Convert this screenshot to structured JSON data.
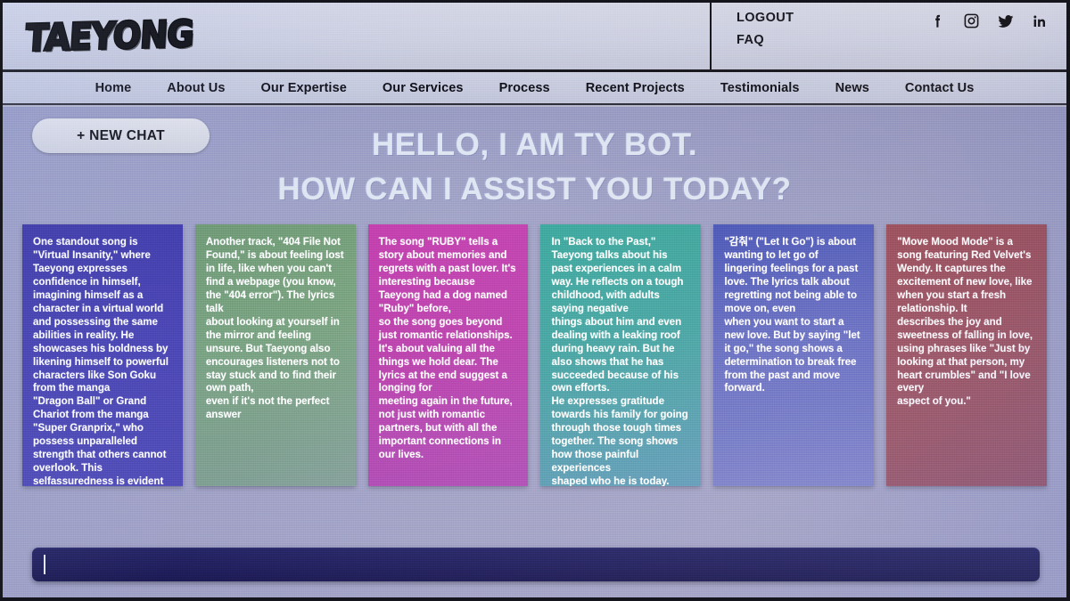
{
  "brand": {
    "logo_text": "TAEYONG"
  },
  "top_bar": {
    "links": [
      {
        "label": "LOGOUT"
      },
      {
        "label": "FAQ"
      }
    ],
    "socials": [
      {
        "name": "facebook-icon",
        "label": "f"
      },
      {
        "name": "instagram-icon",
        "label": ""
      },
      {
        "name": "twitter-icon",
        "label": ""
      },
      {
        "name": "linkedin-icon",
        "label": "in"
      }
    ]
  },
  "nav": {
    "items": [
      {
        "label": "Home"
      },
      {
        "label": "About Us"
      },
      {
        "label": "Our Expertise"
      },
      {
        "label": "Our Services"
      },
      {
        "label": "Process"
      },
      {
        "label": "Recent Projects"
      },
      {
        "label": "Testimonials"
      },
      {
        "label": "News"
      },
      {
        "label": "Contact Us"
      }
    ]
  },
  "main": {
    "new_chat_label": "+ NEW CHAT",
    "headline_line1": "HELLO, I AM TY BOT.",
    "headline_line2": "HOW CAN I ASSIST YOU TODAY?",
    "cards": [
      {
        "accent": "#4a44b4",
        "text": "One standout song is \"Virtual Insanity,\" where Taeyong expresses confidence in himself, imagining himself as a character in a virtual world and possessing the same abilities in reality. He showcases his boldness by likening himself to powerful characters like Son Goku from the manga\n\"Dragon Ball\" or Grand Chariot from the manga \"Super Granprix,\" who possess unparalleled strength that others cannot overlook. This selfassuredness is evident in the song as well."
      },
      {
        "accent": "#7ea585",
        "text": "Another track, \"404 File Not Found,\" is about feeling lost in life, like when you can't find a webpage (you know, the \"404 error\"). The lyrics talk\nabout looking at yourself in the mirror and feeling unsure. But Taeyong also encourages listeners not to stay stuck and to find their own path,\neven if it's not the perfect answer"
      },
      {
        "accent": "#bd45b0",
        "text": "The song \"RUBY\" tells a story about memories and regrets with a past lover. It's interesting because Taeyong had a dog named \"Ruby\" before,\nso the song goes beyond just romantic relationships. It's about valuing all the things we hold dear. The lyrics at the end suggest a longing for\nmeeting again in the future, not just with romantic partners, but with all the important connections in our lives."
      },
      {
        "accent": "#49a8a6",
        "text": "In \"Back to the Past,\" Taeyong talks about his past experiences in a calm way. He reflects on a tough childhood, with adults saying negative\nthings about him and even dealing with a leaking roof during heavy rain. But he also shows that he has succeeded because of his own efforts.\nHe expresses gratitude towards his family for going through those tough times together. The song shows how those painful experiences\nshaped who he is today."
      },
      {
        "accent": "#6e76c4",
        "text": "\"감춰\" (\"Let It Go\") is about wanting to let go of lingering feelings for a past love. The lyrics talk about regretting not being able to move on, even\nwhen you want to start a new love. But by saying \"let it go,\" the song shows a determination to break free from the past and move forward."
      },
      {
        "accent": "#a25a6c",
        "text": "\"Move Mood Mode\" is a song featuring Red Velvet's Wendy. It captures the excitement of new love, like when you start a fresh relationship. It\ndescribes the joy and sweetness of falling in love, using phrases like \"Just by looking at that person, my heart crumbles\" and \"I love every\naspect of you.\""
      }
    ],
    "chat_input": {
      "value": "",
      "placeholder": ""
    }
  },
  "colors": {
    "page_bg": "#a5a6c6",
    "header_bg": "#d0d3e2",
    "input_bg": "#26246e",
    "headline": "#dfe6f2"
  }
}
